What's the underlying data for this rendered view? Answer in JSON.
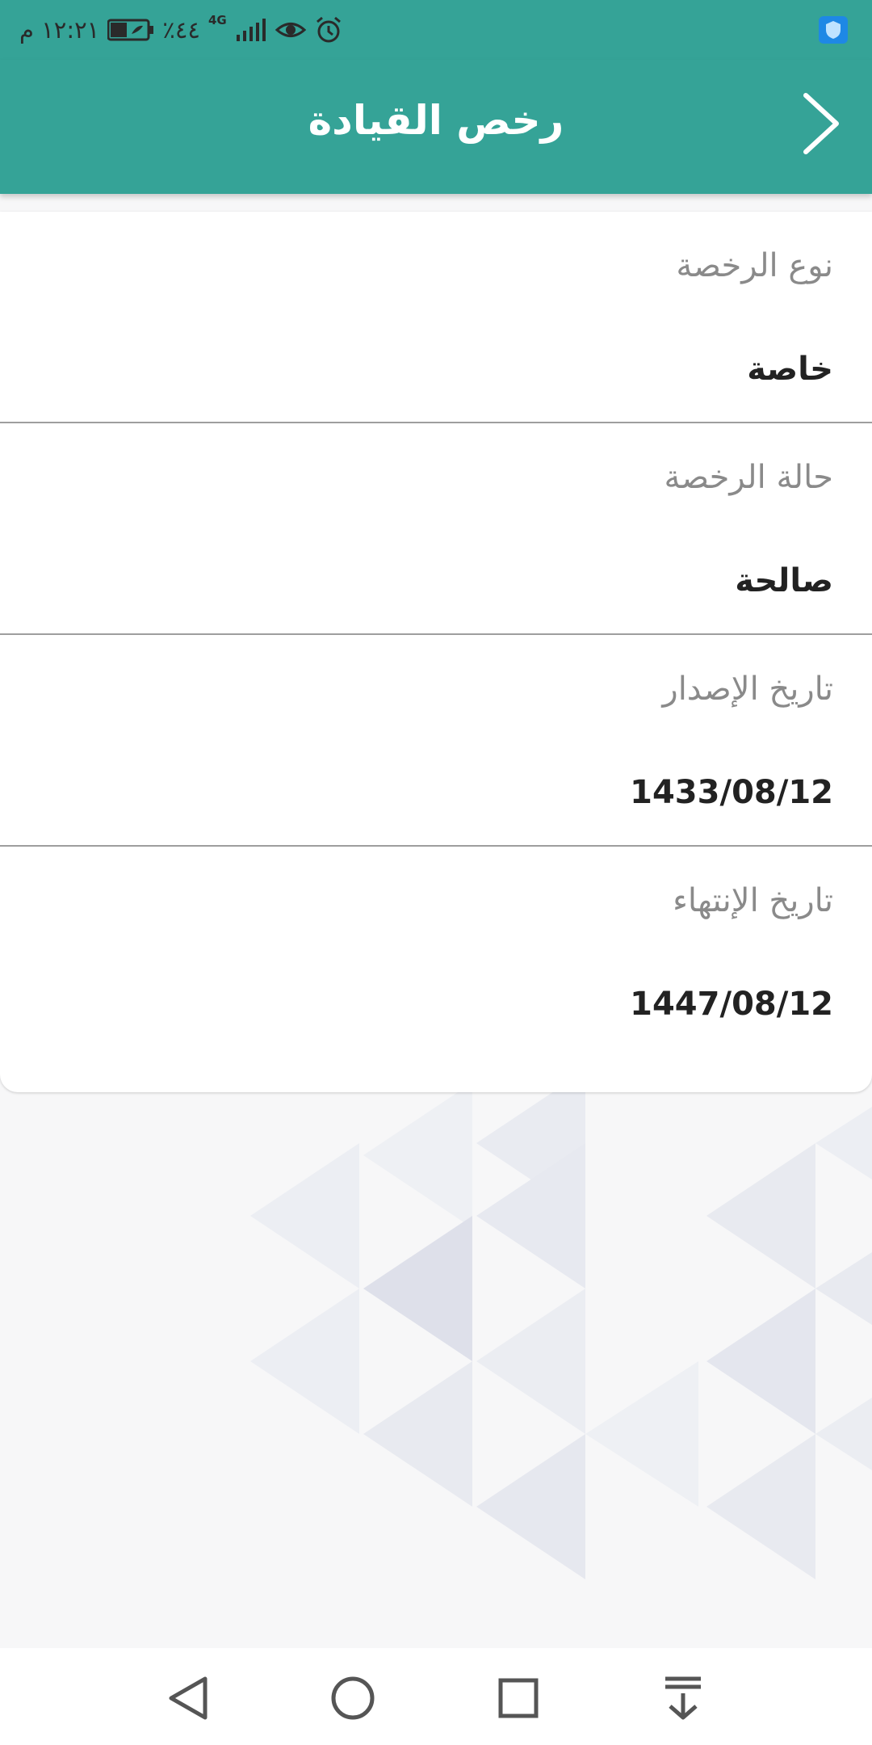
{
  "status_bar": {
    "time": "١٢:٢١ م",
    "battery": "٪٤٤",
    "network": "4G"
  },
  "app_bar": {
    "title": "رخص القيادة"
  },
  "fields": [
    {
      "label": "نوع الرخصة",
      "value": "خاصة"
    },
    {
      "label": "حالة الرخصة",
      "value": "صالحة"
    },
    {
      "label": "تاريخ الإصدار",
      "value": "1433/08/12"
    },
    {
      "label": "تاريخ الإنتهاء",
      "value": "1447/08/12"
    }
  ],
  "colors": {
    "primary": "#35a397",
    "shield": "#1e88e5"
  },
  "icons": {
    "back": "chevron-right-icon",
    "nav_back": "triangle-back-icon",
    "nav_home": "circle-home-icon",
    "nav_recents": "square-recents-icon",
    "nav_notifications": "pull-down-icon"
  }
}
